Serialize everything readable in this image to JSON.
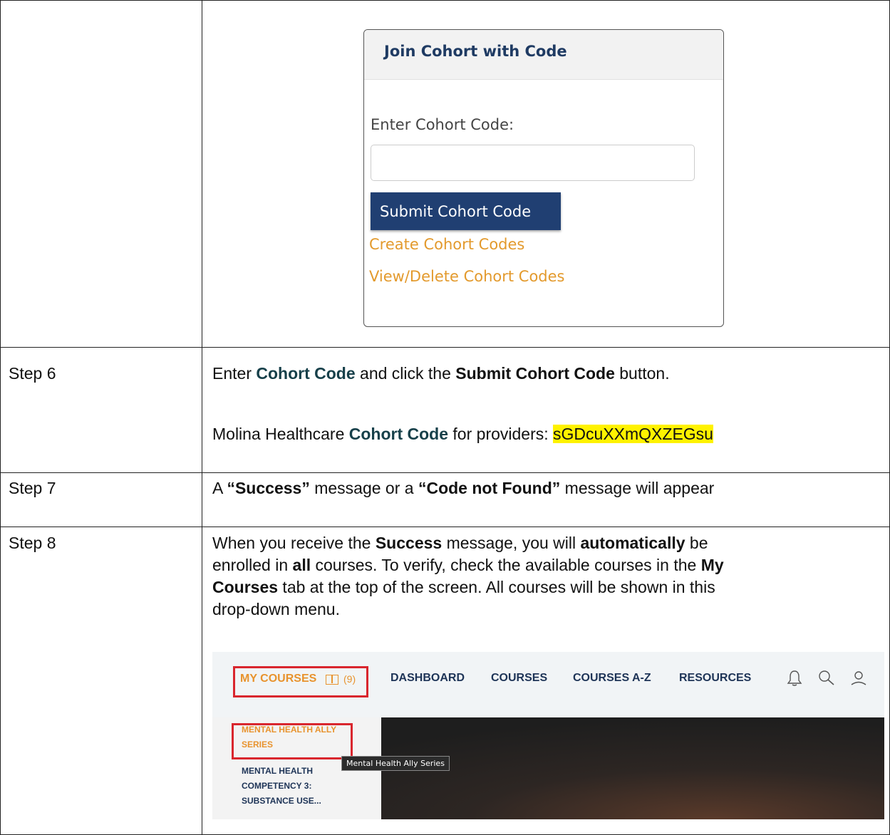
{
  "cohort_card": {
    "title": "Join Cohort with Code",
    "input_label": "Enter Cohort Code:",
    "input_value": "",
    "submit_label": "Submit Cohort Code",
    "link_create": "Create Cohort Codes",
    "link_view": "View/Delete Cohort Codes"
  },
  "steps": [
    {
      "label": "Step 6",
      "l1a": "Enter ",
      "l1b": "Cohort Code",
      "l1c": " and click the ",
      "l1d": "Submit Cohort Code",
      "l1e": " button.",
      "l2a": "Molina Healthcare ",
      "l2b": "Cohort Code",
      "l2c": " for providers: ",
      "l2d": "sGDcuXXmQXZEGsu"
    },
    {
      "label": "Step 7",
      "a": "A ",
      "b": "“Success”",
      "c": " message or a ",
      "d": "“Code not Found”",
      "e": " message will appear"
    },
    {
      "label": "Step 8",
      "p1": "When you receive the ",
      "p2": "Success",
      "p3": " message, you will ",
      "p4": "automatically",
      "p5": " be",
      "p6": "enrolled in ",
      "p7": "all",
      "p8": " courses. To verify, check the available courses in the ",
      "p9": "My",
      "p10": "Courses",
      "p11": " tab at the top of the screen. All courses will be shown in this",
      "p12": "drop-down menu."
    }
  ],
  "screenshot": {
    "nav": {
      "my_courses": "MY COURSES",
      "my_courses_count": "(9)",
      "dashboard": "DASHBOARD",
      "courses": "COURSES",
      "courses_az": "COURSES A-Z",
      "resources": "RESOURCES",
      "icons": [
        "bell-icon",
        "search-icon",
        "user-icon"
      ]
    },
    "dropdown": {
      "item1_line1": "MENTAL HEALTH ALLY",
      "item1_line2": "SERIES",
      "item2_line1": "MENTAL HEALTH",
      "item2_line2": "COMPETENCY 3:",
      "item2_line3": "SUBSTANCE USE..."
    },
    "tooltip": "Mental Health Ally Series"
  },
  "colors": {
    "accent_orange": "#e39a2d",
    "button_navy": "#203f72",
    "highlight_red": "#d9262e",
    "highlight_yellow": "#fff200"
  }
}
